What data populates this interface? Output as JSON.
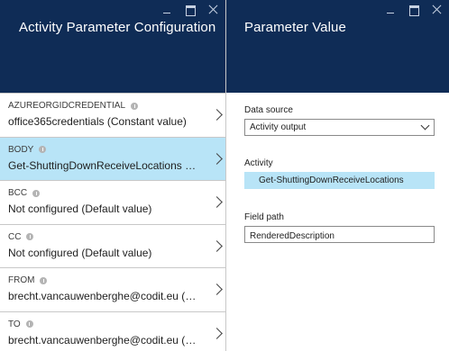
{
  "left_blade": {
    "title": "Activity Parameter Configuration",
    "parameters": [
      {
        "name": "AZUREORGIDCREDENTIAL",
        "value": "office365credentials (Constant value)",
        "selected": false
      },
      {
        "name": "BODY",
        "value": "Get-ShuttingDownReceiveLocations (Acti...",
        "selected": true
      },
      {
        "name": "BCC",
        "value": "Not configured (Default value)",
        "selected": false
      },
      {
        "name": "CC",
        "value": "Not configured (Default value)",
        "selected": false
      },
      {
        "name": "FROM",
        "value": "brecht.vancauwenberghe@codit.eu (Con...",
        "selected": false
      },
      {
        "name": "TO",
        "value": "brecht.vancauwenberghe@codit.eu (Con...",
        "selected": false
      }
    ]
  },
  "right_blade": {
    "title": "Parameter Value",
    "data_source": {
      "label": "Data source",
      "selected": "Activity output"
    },
    "activity": {
      "label": "Activity",
      "value": "Get-ShuttingDownReceiveLocations"
    },
    "field_path": {
      "label": "Field path",
      "value": "RenderedDescription"
    }
  },
  "colors": {
    "header_background": "#0f2c56",
    "selection_highlight": "#b8e4f7"
  },
  "icons": {
    "header_controls": [
      "minimize-icon",
      "maximize-icon",
      "close-icon"
    ],
    "row_chevron": "chevron-right-icon",
    "info": "info-icon",
    "dropdown": "chevron-down-icon"
  }
}
